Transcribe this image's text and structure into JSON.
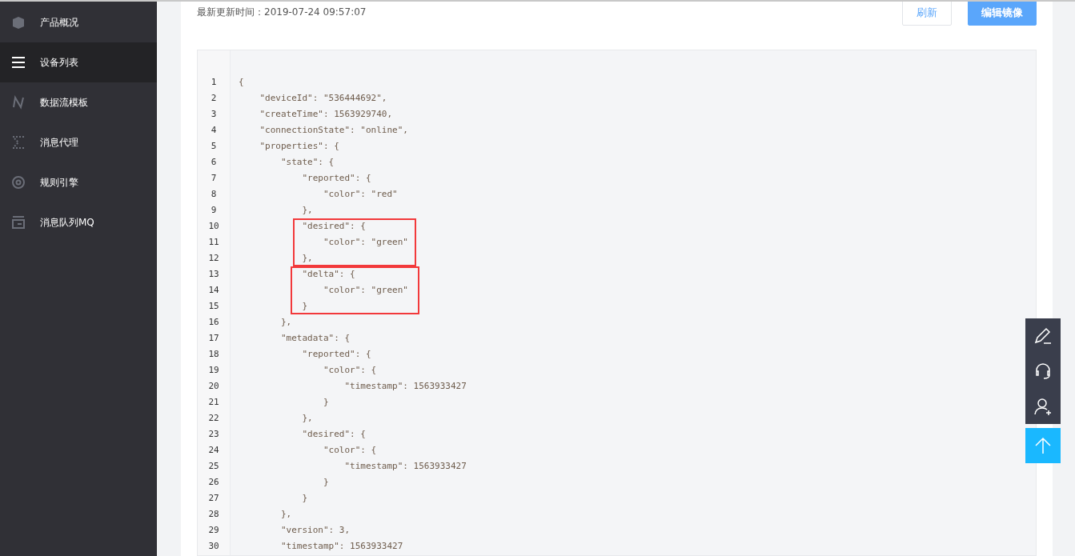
{
  "sidebar": {
    "items": [
      {
        "label": "产品概况",
        "selected": false
      },
      {
        "label": "设备列表",
        "selected": true
      },
      {
        "label": "数据流模板",
        "selected": false
      },
      {
        "label": "消息代理",
        "selected": false
      },
      {
        "label": "规则引擎",
        "selected": false
      },
      {
        "label": "消息队列MQ",
        "selected": false
      }
    ]
  },
  "header": {
    "updated_time": "最新更新时间：2019-07-24 09:57:07",
    "buttons": [
      {
        "label": "刷新",
        "kind": "secondary"
      },
      {
        "label": "编辑镜像",
        "kind": "primary"
      }
    ]
  },
  "code": {
    "segments": [
      {
        "highlighted": false,
        "lines": [
          {
            "number": "1",
            "text": "{"
          },
          {
            "number": "2",
            "text": "    \"deviceId\": \"536444692\","
          },
          {
            "number": "3",
            "text": "    \"createTime\": 1563929740,"
          },
          {
            "number": "4",
            "text": "    \"connectionState\": \"online\","
          },
          {
            "number": "5",
            "text": "    \"properties\": {"
          },
          {
            "number": "6",
            "text": "        \"state\": {"
          },
          {
            "number": "7",
            "text": "            \"reported\": {"
          },
          {
            "number": "8",
            "text": "                \"color\": \"red\""
          },
          {
            "number": "9",
            "text": "            },"
          }
        ]
      },
      {
        "highlighted": true,
        "lines": [
          {
            "number": "10",
            "text": "            \"desired\": {"
          },
          {
            "number": "11",
            "text": "                \"color\": \"green\""
          },
          {
            "number": "12",
            "text": "            },"
          }
        ]
      },
      {
        "highlighted": true,
        "lines": [
          {
            "number": "13",
            "text": "            \"delta\": {"
          },
          {
            "number": "14",
            "text": "                \"color\": \"green\""
          },
          {
            "number": "15",
            "text": "            }"
          }
        ]
      },
      {
        "highlighted": false,
        "lines": [
          {
            "number": "16",
            "text": "        },"
          },
          {
            "number": "17",
            "text": "        \"metadata\": {"
          },
          {
            "number": "18",
            "text": "            \"reported\": {"
          },
          {
            "number": "19",
            "text": "                \"color\": {"
          },
          {
            "number": "20",
            "text": "                    \"timestamp\": 1563933427"
          },
          {
            "number": "21",
            "text": "                }"
          },
          {
            "number": "22",
            "text": "            },"
          },
          {
            "number": "23",
            "text": "            \"desired\": {"
          },
          {
            "number": "24",
            "text": "                \"color\": {"
          },
          {
            "number": "25",
            "text": "                    \"timestamp\": 1563933427"
          },
          {
            "number": "26",
            "text": "                }"
          },
          {
            "number": "27",
            "text": "            }"
          },
          {
            "number": "28",
            "text": "        },"
          },
          {
            "number": "29",
            "text": "        \"version\": 3,"
          },
          {
            "number": "30",
            "text": "        \"timestamp\": 1563933427"
          }
        ]
      }
    ]
  },
  "float_toolbar": [
    {
      "kind": "tool"
    },
    {
      "kind": "tool"
    },
    {
      "kind": "tool"
    },
    {
      "kind": "top"
    }
  ]
}
